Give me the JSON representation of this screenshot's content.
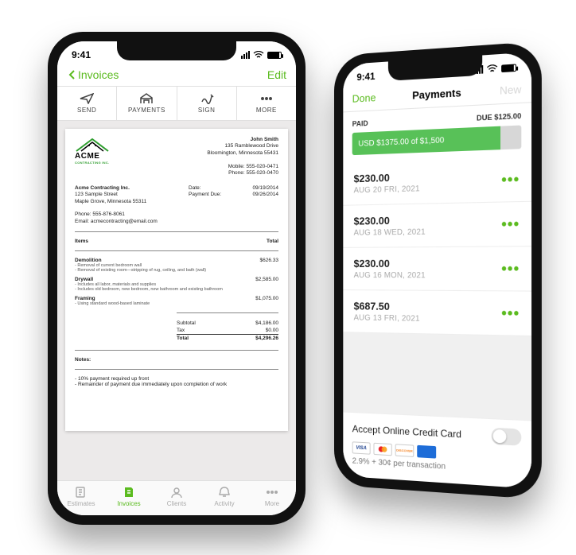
{
  "status": {
    "time": "9:41"
  },
  "phone1": {
    "nav": {
      "back_label": "Invoices",
      "edit_label": "Edit"
    },
    "toolbar": {
      "send": "SEND",
      "payments": "PAYMENTS",
      "sign": "SIGN",
      "more": "MORE"
    },
    "invoice": {
      "logo_name": "ACME",
      "logo_sub": "CONTRACTING INC.",
      "client": {
        "name": "John Smith",
        "addr1": "135 Ramblewood Drive",
        "addr2": "Bloomington, Minnesota 55431",
        "mobile": "Mobile: 555-020-0471",
        "phone": "Phone: 555-020-0470"
      },
      "company": {
        "name": "Acme Contracting Inc.",
        "addr1": "123 Sample Street",
        "addr2": "Maple Grove, Minnesota 55311",
        "phone": "Phone: 555-876-8061",
        "email": "Email: acmecontracting@email.com"
      },
      "dates": {
        "date_label": "Date:",
        "date_value": "09/19/2014",
        "due_label": "Payment Due:",
        "due_value": "09/26/2014"
      },
      "items_header_left": "Items",
      "items_header_right": "Total",
      "items": [
        {
          "title": "Demolition",
          "amount": "$626.33",
          "desc1": "- Removal of current bedroom wall",
          "desc2": "- Removal of existing room—stripping of rug, ceiling, and bath (wall)"
        },
        {
          "title": "Drywall",
          "amount": "$2,585.00",
          "desc1": "- Includes all labor, materials and supplies",
          "desc2": "- Includes old bedroom, new bedroom, new bathroom and existing bathroom"
        },
        {
          "title": "Framing",
          "amount": "$1,075.00",
          "desc1": "- Using standard wood-based laminate"
        }
      ],
      "totals": {
        "subtotal_label": "Subtotal",
        "subtotal": "$4,186.00",
        "tax_label": "Tax",
        "tax": "$0.00",
        "total_label": "Total",
        "total": "$4,296.26"
      },
      "notes_header": "Notes:",
      "notes1": "- 10% payment required up front",
      "notes2": "- Remainder of payment due immediately upon completion of work"
    },
    "tabbar": {
      "estimates": "Estimates",
      "invoices": "Invoices",
      "clients": "Clients",
      "activity": "Activity",
      "more": "More"
    }
  },
  "phone2": {
    "nav": {
      "done": "Done",
      "title": "Payments",
      "new": "New"
    },
    "paid_label": "PAID",
    "due_label": "DUE $125.00",
    "progress_text": "USD $1375.00 of $1,500",
    "payments": [
      {
        "amount": "$230.00",
        "date": "AUG 20 FRI, 2021"
      },
      {
        "amount": "$230.00",
        "date": "AUG 18 WED, 2021"
      },
      {
        "amount": "$230.00",
        "date": "AUG 16 MON, 2021"
      },
      {
        "amount": "$687.50",
        "date": "AUG 13 FRI, 2021"
      }
    ],
    "accept_label": "Accept Online Credit Card",
    "fee_text": "2.9% + 30¢ per transaction",
    "cards": {
      "visa": "VISA",
      "mc": "MC",
      "disc": "DISCOVER",
      "amex": "AMEX"
    }
  }
}
